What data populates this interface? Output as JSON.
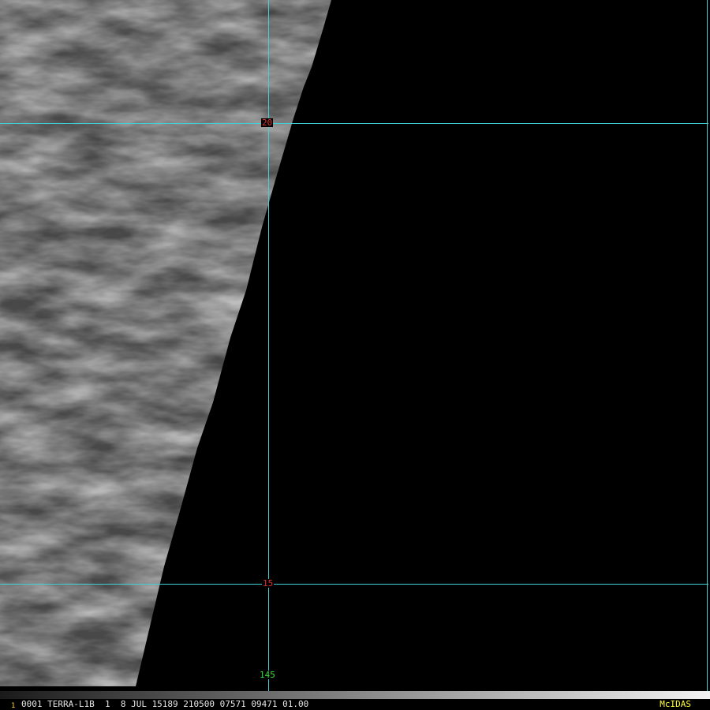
{
  "map": {
    "latitude_labels": [
      "20",
      "15"
    ],
    "longitude_labels": [
      "145"
    ],
    "grid_color": "#3fd0d8",
    "latitude_label_color": "#e03030",
    "longitude_label_color": "#38e038"
  },
  "status": {
    "frame_number": "1",
    "text": "0001 TERRA-L1B  1  8 JUL 15189 210500 07571 09471 01.00",
    "brand": "McIDAS"
  }
}
